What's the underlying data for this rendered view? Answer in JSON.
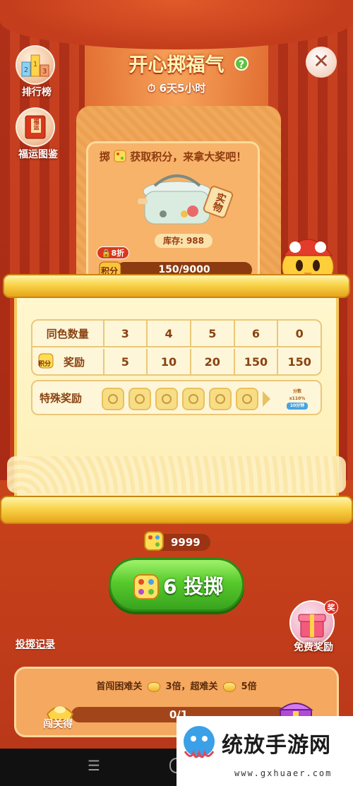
{
  "header": {
    "title": "开心掷福气",
    "help": "?",
    "timer": "6天5小时",
    "close": "✕"
  },
  "left_icons": [
    {
      "label": "排行榜",
      "icon": "ranking-podium-icon"
    },
    {
      "label": "福运图鉴",
      "icon": "fortune-book-icon",
      "book_text": "福运"
    }
  ],
  "prize": {
    "title": "掷",
    "title_rest": "获取积分，来拿大奖吧！",
    "tag": "实物",
    "stock": "库存: 988",
    "discount": "8折",
    "score_label": "积分",
    "score_text": "150/9000",
    "score_progress": 0.0167
  },
  "reward_table": {
    "row1_header": "同色数量",
    "row1_values": [
      "3",
      "4",
      "5",
      "6",
      "0"
    ],
    "row2_header": "奖励",
    "row2_icon_label": "积分",
    "row2_values": [
      "5",
      "10",
      "20",
      "150",
      "150"
    ],
    "special_label": "特殊奖励",
    "special_slots": 6,
    "badge_lines": [
      "分数",
      "x110%",
      "10分钟"
    ]
  },
  "points": {
    "value": "9999"
  },
  "roll_button": {
    "count": "6",
    "label": "投掷"
  },
  "roll_record": "投掷记录",
  "free_reward": {
    "label": "免费奖励",
    "badge": "奖"
  },
  "bonus": {
    "prefix": "首闯困难关",
    "mult1": "3倍",
    "middle": "，超难关",
    "mult2": "5倍",
    "pass_label": "闯关得",
    "progress_text": "0/1",
    "progress": 0
  },
  "nav": {
    "menu": "☰"
  },
  "watermark": {
    "text": "统放手游网",
    "url": "www.gxhuaer.com"
  },
  "colors": {
    "roll_green": "#58c92c",
    "scroll_gold": "#f9d34a",
    "stage_red": "#c7421a"
  }
}
